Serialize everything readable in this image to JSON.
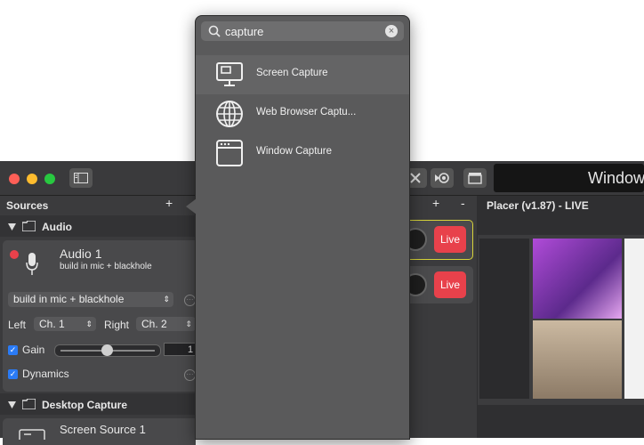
{
  "popup": {
    "search_value": "capture",
    "items": [
      {
        "label": "Screen Capture",
        "icon": "monitor-icon"
      },
      {
        "label": "Web Browser Captu...",
        "icon": "globe-icon"
      },
      {
        "label": "Window Capture",
        "icon": "window-icon"
      }
    ]
  },
  "window": {
    "title_fragment": "Window",
    "sources_title": "Sources",
    "add_symbol": "+",
    "audio_group": "Audio",
    "audio_source": {
      "name": "Audio 1",
      "subtitle": "build in mic + blackhole",
      "device": "build in mic + blackhole",
      "left_label": "Left",
      "left_value": "Ch. 1",
      "right_label": "Right",
      "right_value": "Ch. 2",
      "gain_label": "Gain",
      "gain_value": "1",
      "dynamics_label": "Dynamics"
    },
    "desktop_group": "Desktop Capture",
    "desktop_source_name": "Screen Source 1",
    "scenes": {
      "add": "+",
      "remove": "-",
      "live_label": "Live"
    },
    "preview": {
      "title": "Placer (v1.87) - LIVE"
    }
  },
  "colors": {
    "accent_live": "#e8414b",
    "checkbox_blue": "#2a7bf6",
    "popup_bg": "#5a5a5b"
  }
}
